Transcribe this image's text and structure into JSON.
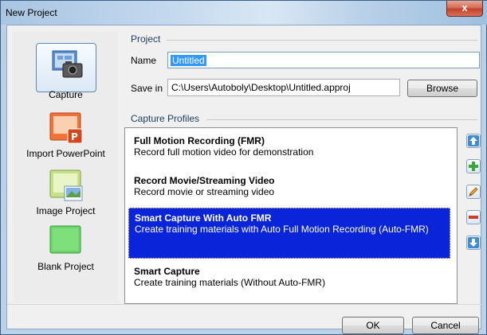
{
  "window": {
    "title": "New Project",
    "close_label": "x"
  },
  "sidebar": {
    "items": [
      {
        "label": "Capture",
        "icon": "camera-icon",
        "selected": true
      },
      {
        "label": "Import PowerPoint",
        "icon": "powerpoint-icon",
        "selected": false
      },
      {
        "label": "Image Project",
        "icon": "image-icon",
        "selected": false
      },
      {
        "label": "Blank Project",
        "icon": "blank-project-icon",
        "selected": false
      }
    ]
  },
  "project": {
    "group_label": "Project",
    "name_label": "Name",
    "name_value": "Untitled",
    "save_in_label": "Save in",
    "save_in_value": "C:\\Users\\Autoboly\\Desktop\\Untitled.approj",
    "browse_label": "Browse"
  },
  "capture_profiles": {
    "group_label": "Capture Profiles",
    "items": [
      {
        "title": "Full Motion Recording (FMR)",
        "desc": "Record full motion video for demonstration",
        "selected": false
      },
      {
        "title": "Record Movie/Streaming Video",
        "desc": "Record movie or streaming video",
        "selected": false
      },
      {
        "title": "Smart Capture With Auto FMR",
        "desc": "Create training materials with Auto Full Motion Recording (Auto-FMR)",
        "selected": true
      },
      {
        "title": "Smart Capture",
        "desc": "Create training materials (Without Auto-FMR)",
        "selected": false
      }
    ],
    "tools": [
      "move-up-icon",
      "add-icon",
      "edit-icon",
      "remove-icon",
      "move-down-icon"
    ]
  },
  "footer": {
    "ok_label": "OK",
    "cancel_label": "Cancel"
  },
  "colors": {
    "selection": "#0a24d9",
    "accent": "#3399ff"
  }
}
